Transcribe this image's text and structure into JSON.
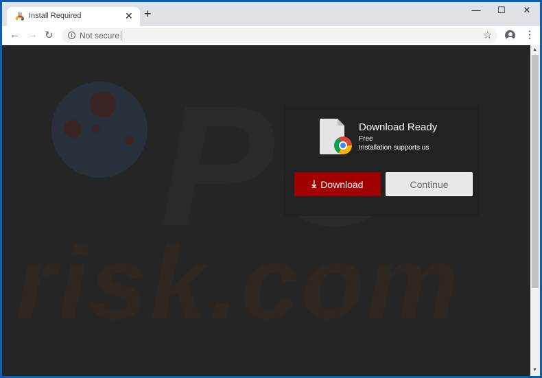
{
  "browser": {
    "tab": {
      "title": "Install Required",
      "close": "✕"
    },
    "new_tab": "+",
    "window_controls": {
      "minimize": "—",
      "maximize": "☐",
      "close": "✕"
    },
    "nav": {
      "back": "←",
      "forward": "→",
      "reload": "↻"
    },
    "omnibox": {
      "security_icon": "i",
      "security_label": "Not secure",
      "url": ""
    },
    "bookmark_star": "☆",
    "menu": "⋮"
  },
  "watermark": {
    "top": "PC",
    "bottom": "risk.com"
  },
  "dialog": {
    "title": "Download Ready",
    "line1": "Free",
    "line2": "Installation supports us",
    "download_icon": "⤓",
    "download_label": "Download",
    "continue_label": "Continue"
  },
  "scrollbar": {
    "up": "▲",
    "down": "▼"
  }
}
